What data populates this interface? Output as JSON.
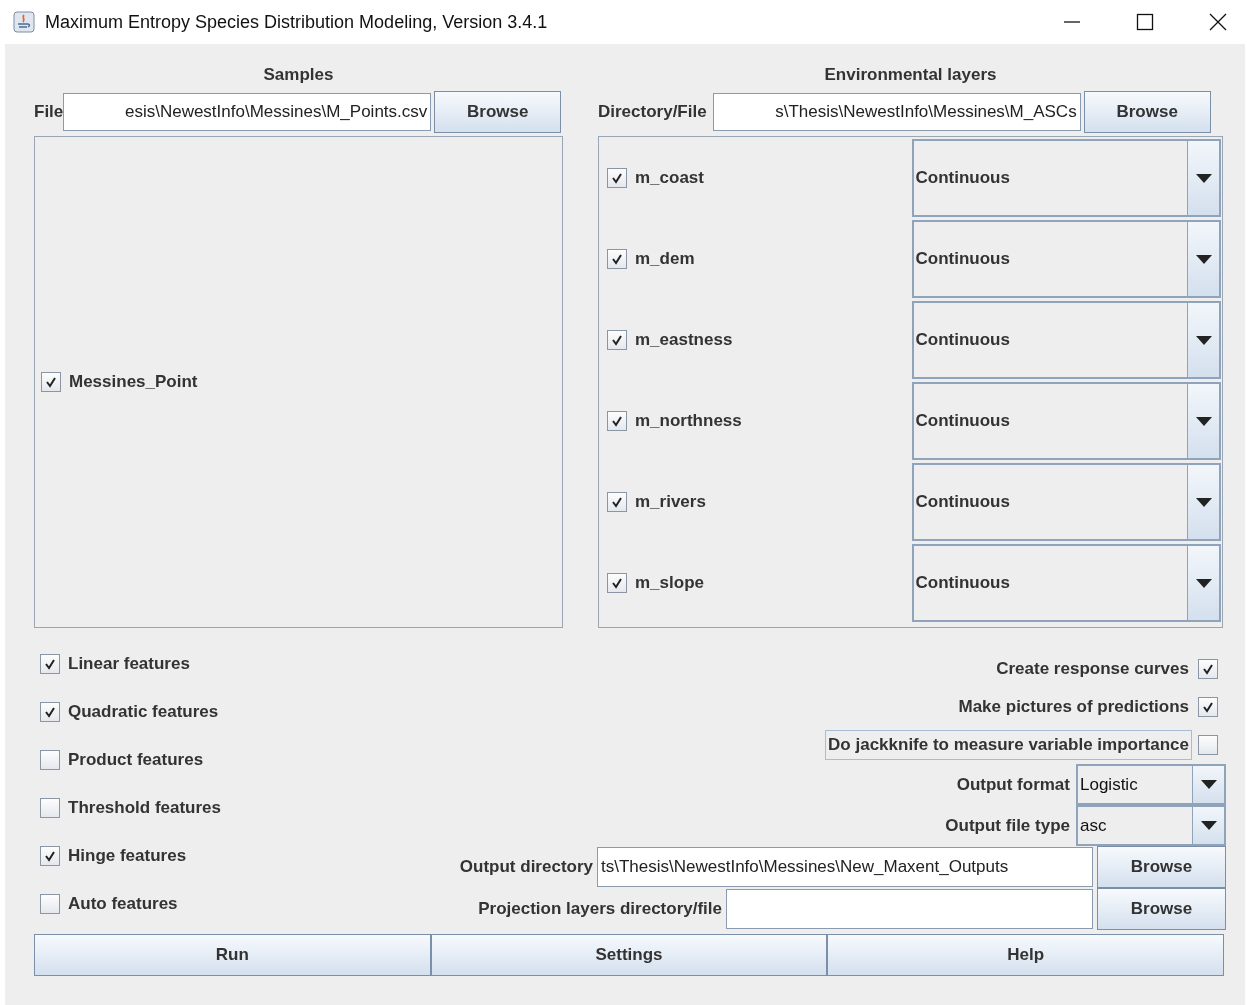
{
  "window": {
    "title": "Maximum Entropy Species Distribution Modeling, Version 3.4.1"
  },
  "samples": {
    "heading": "Samples",
    "file_label": "File",
    "file_value": "esis\\NewestInfo\\Messines\\M_Points.csv",
    "browse": "Browse",
    "items": [
      {
        "label": "Messines_Point",
        "checked": true
      }
    ]
  },
  "environmental_layers": {
    "heading": "Environmental layers",
    "dir_label": "Directory/File",
    "dir_value": "s\\Thesis\\NewestInfo\\Messines\\M_ASCs",
    "browse": "Browse",
    "layers": [
      {
        "name": "m_coast",
        "checked": true,
        "type": "Continuous"
      },
      {
        "name": "m_dem",
        "checked": true,
        "type": "Continuous"
      },
      {
        "name": "m_eastness",
        "checked": true,
        "type": "Continuous"
      },
      {
        "name": "m_northness",
        "checked": true,
        "type": "Continuous"
      },
      {
        "name": "m_rivers",
        "checked": true,
        "type": "Continuous"
      },
      {
        "name": "m_slope",
        "checked": true,
        "type": "Continuous"
      }
    ]
  },
  "features": [
    {
      "label": "Linear features",
      "checked": true
    },
    {
      "label": "Quadratic features",
      "checked": true
    },
    {
      "label": "Product features",
      "checked": false
    },
    {
      "label": "Threshold features",
      "checked": false
    },
    {
      "label": "Hinge features",
      "checked": true
    },
    {
      "label": "Auto features",
      "checked": false
    }
  ],
  "options": [
    {
      "label": "Create response curves",
      "checked": true,
      "focused": false
    },
    {
      "label": "Make pictures of predictions",
      "checked": true,
      "focused": false
    },
    {
      "label": "Do jackknife to measure variable importance",
      "checked": false,
      "focused": true
    }
  ],
  "output_format": {
    "label": "Output format",
    "value": "Logistic"
  },
  "output_file_type": {
    "label": "Output file type",
    "value": "asc"
  },
  "output_directory": {
    "label": "Output directory",
    "value": "ts\\Thesis\\NewestInfo\\Messines\\New_Maxent_Outputs",
    "browse": "Browse"
  },
  "projection_layers": {
    "label": "Projection layers directory/file",
    "browse": "Browse"
  },
  "buttons": [
    "Run",
    "Settings",
    "Help"
  ]
}
